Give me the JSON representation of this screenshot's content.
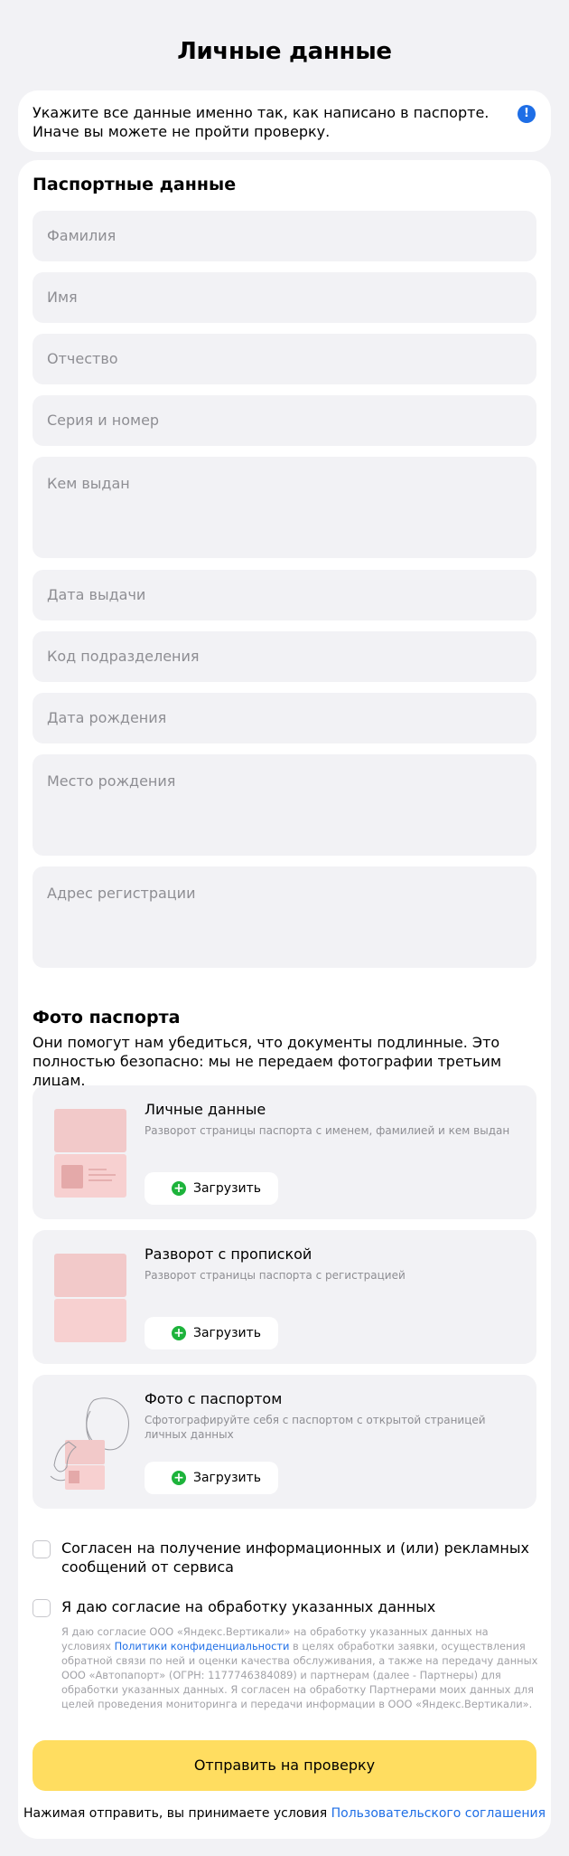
{
  "page": {
    "title": "Личные данные"
  },
  "notice": {
    "text": "Укажите все данные именно так, как написано в паспорте. Иначе вы можете не пройти проверку.",
    "icon": "!"
  },
  "passport": {
    "title": "Паспортные данные",
    "fields": {
      "surname": "Фамилия",
      "name": "Имя",
      "patronymic": "Отчество",
      "series_number": "Серия и номер",
      "issued_by": "Кем выдан",
      "issue_date": "Дата выдачи",
      "division_code": "Код подразделения",
      "birth_date": "Дата рождения",
      "birth_place": "Место рождения",
      "registration_address": "Адрес регистрации"
    }
  },
  "photos": {
    "title": "Фото паспорта",
    "description": "Они помогут нам убедиться, что документы подлинные. Это полностью безопасно: мы не передаем фотографии третьим лицам.",
    "upload_label": "Загрузить",
    "upload_icon": "+",
    "items": [
      {
        "title": "Личные данные",
        "subtitle": "Разворот страницы паспорта с именем, фамилией и кем выдан"
      },
      {
        "title": "Разворот с пропиской",
        "subtitle": "Разворот страницы паспорта с регистрацией"
      },
      {
        "title": "Фото с паспортом",
        "subtitle": "Сфотографируйте себя с паспортом с открытой страницей личных данных"
      }
    ]
  },
  "consents": {
    "marketing": "Согласен на получение информационных и (или) рекламных сообщений от сервиса",
    "processing": "Я даю согласие на обработку указанных данных",
    "legal_before_link": "Я даю согласие ООО «Яндекс.Вертикали» на обработку указанных данных на условиях ",
    "legal_link": "Политики конфиденциальности",
    "legal_after_link": " в целях обработки заявки, осуществления обратной связи по ней и оценки качества обслуживания, а также на передачу данных ООО «Автопапорт» (ОГРН: 1177746384089) и партнерам (далее - Партнеры) для обработки указанных данных. Я согласен на обработку Партнерами моих данных для целей проведения мониторинга и передачи информации в ООО «Яндекс.Вертикали»."
  },
  "submit": {
    "label": "Отправить на проверку",
    "terms_prefix": "Нажимая отправить, вы принимаете условия ",
    "terms_link": "Пользовательского соглашения"
  },
  "colors": {
    "accent": "#ffdd60",
    "link": "#1e6ee6",
    "success": "#1db33b",
    "background": "#f2f2f5"
  }
}
